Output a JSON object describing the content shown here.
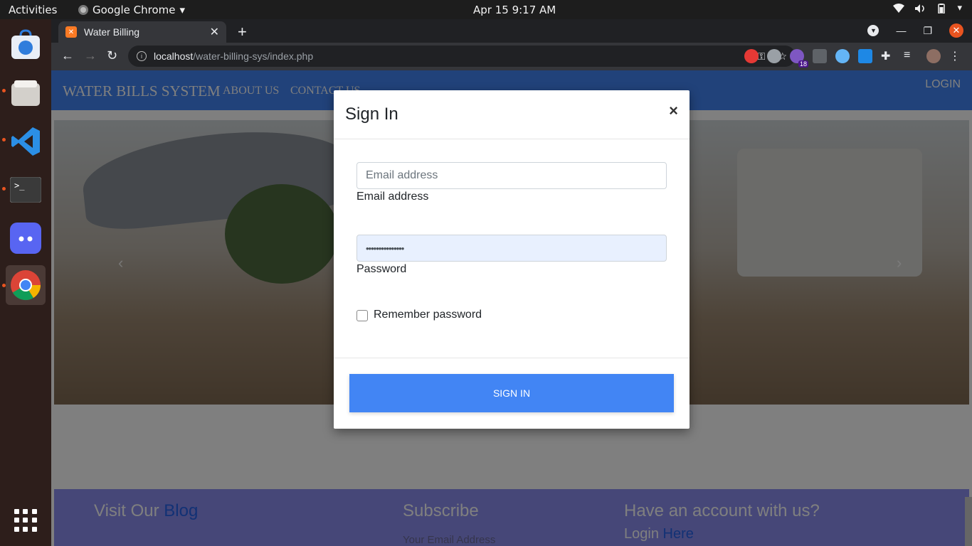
{
  "system": {
    "activities": "Activities",
    "app_name": "Google Chrome",
    "clock": "Apr 15  9:17 AM"
  },
  "dock": {
    "items": [
      "software-center",
      "files",
      "vscode",
      "terminal",
      "discord",
      "chrome"
    ]
  },
  "browser": {
    "tab_title": "Water Billing",
    "url_host": "localhost",
    "url_path": "/water-billing-sys/index.php",
    "extension_badge": "18"
  },
  "site": {
    "brand": "WATER BILLS SYSTEM",
    "nav": {
      "about": "ABOUT US",
      "contact": "CONTACT US",
      "login": "LOGIN"
    },
    "footer": {
      "visit_prefix": "Visit Our ",
      "visit_accent": "Blog",
      "subscribe": "Subscribe",
      "subscribe_placeholder": "Your Email Address",
      "account_q": "Have an account with us?",
      "login_prefix": "Login ",
      "login_accent": "Here"
    }
  },
  "modal": {
    "title": "Sign In",
    "email_placeholder": "Email address",
    "email_label": "Email address",
    "password_value": "•••••••••••••••",
    "password_label": "Password",
    "remember_label": "Remember password",
    "submit_label": "SIGN IN"
  },
  "colors": {
    "brand_blue": "#4285f4",
    "accent_orange": "#e95420",
    "footer_purple": "#8c8ef0"
  }
}
